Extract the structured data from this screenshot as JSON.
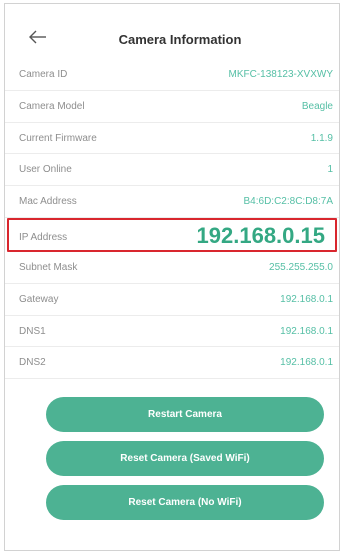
{
  "header": {
    "title": "Camera Information"
  },
  "fields": {
    "camera_id": {
      "label": "Camera ID",
      "value": "MKFC-138123-XVXWY"
    },
    "camera_model": {
      "label": "Camera Model",
      "value": "Beagle"
    },
    "current_firmware": {
      "label": "Current Firmware",
      "value": "1.1.9"
    },
    "user_online": {
      "label": "User Online",
      "value": "1"
    },
    "mac_address": {
      "label": "Mac Address",
      "value": "B4:6D:C2:8C:D8:7A"
    },
    "ip_address": {
      "label": "IP Address",
      "value": "192.168.0.15"
    },
    "subnet_mask": {
      "label": "Subnet Mask",
      "value": "255.255.255.0"
    },
    "gateway": {
      "label": "Gateway",
      "value": "192.168.0.1"
    },
    "dns1": {
      "label": "DNS1",
      "value": "192.168.0.1"
    },
    "dns2": {
      "label": "DNS2",
      "value": "192.168.0.1"
    }
  },
  "buttons": {
    "restart": "Restart Camera",
    "reset_saved_wifi": "Reset Camera (Saved WiFi)",
    "reset_no_wifi": "Reset Camera (No WiFi)"
  },
  "colors": {
    "accent": "#4db293",
    "value_text": "#55bfa5",
    "highlight_border": "#d9262e"
  },
  "icons": {
    "back": "arrow-left-icon"
  }
}
